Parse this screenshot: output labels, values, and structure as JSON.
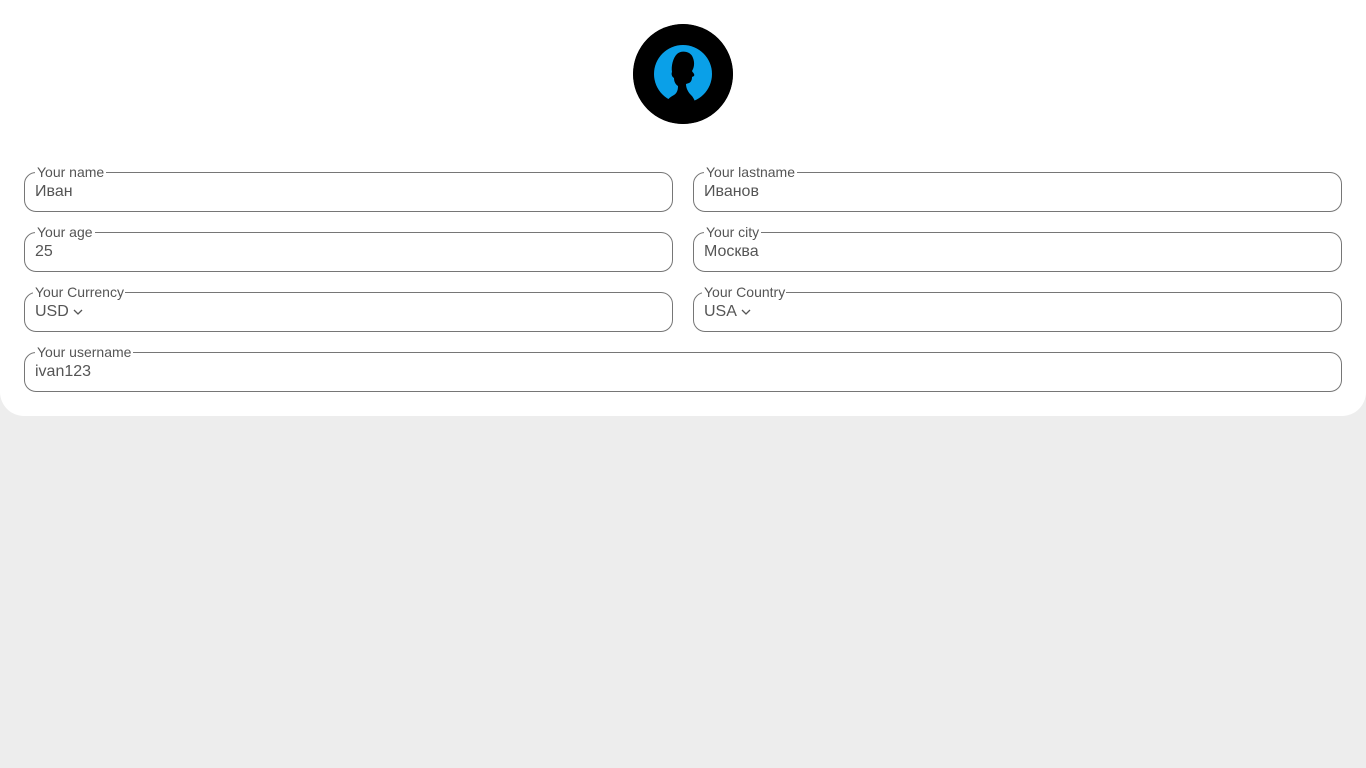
{
  "profile": {
    "avatar": "user-silhouette-avatar"
  },
  "form": {
    "name": {
      "label": "Your name",
      "value": "Иван"
    },
    "lastname": {
      "label": "Your lastname",
      "value": "Иванов"
    },
    "age": {
      "label": "Your age",
      "value": "25"
    },
    "city": {
      "label": "Your city",
      "value": "Москва"
    },
    "currency": {
      "label": "Your Currency",
      "value": "USD"
    },
    "country": {
      "label": "Your Country",
      "value": "USA"
    },
    "username": {
      "label": "Your username",
      "value": "ivan123"
    }
  },
  "colors": {
    "page_bg": "#ededed",
    "card_bg": "#ffffff",
    "avatar_accent": "#0aa0e8",
    "border": "#767676",
    "text": "#555555"
  }
}
